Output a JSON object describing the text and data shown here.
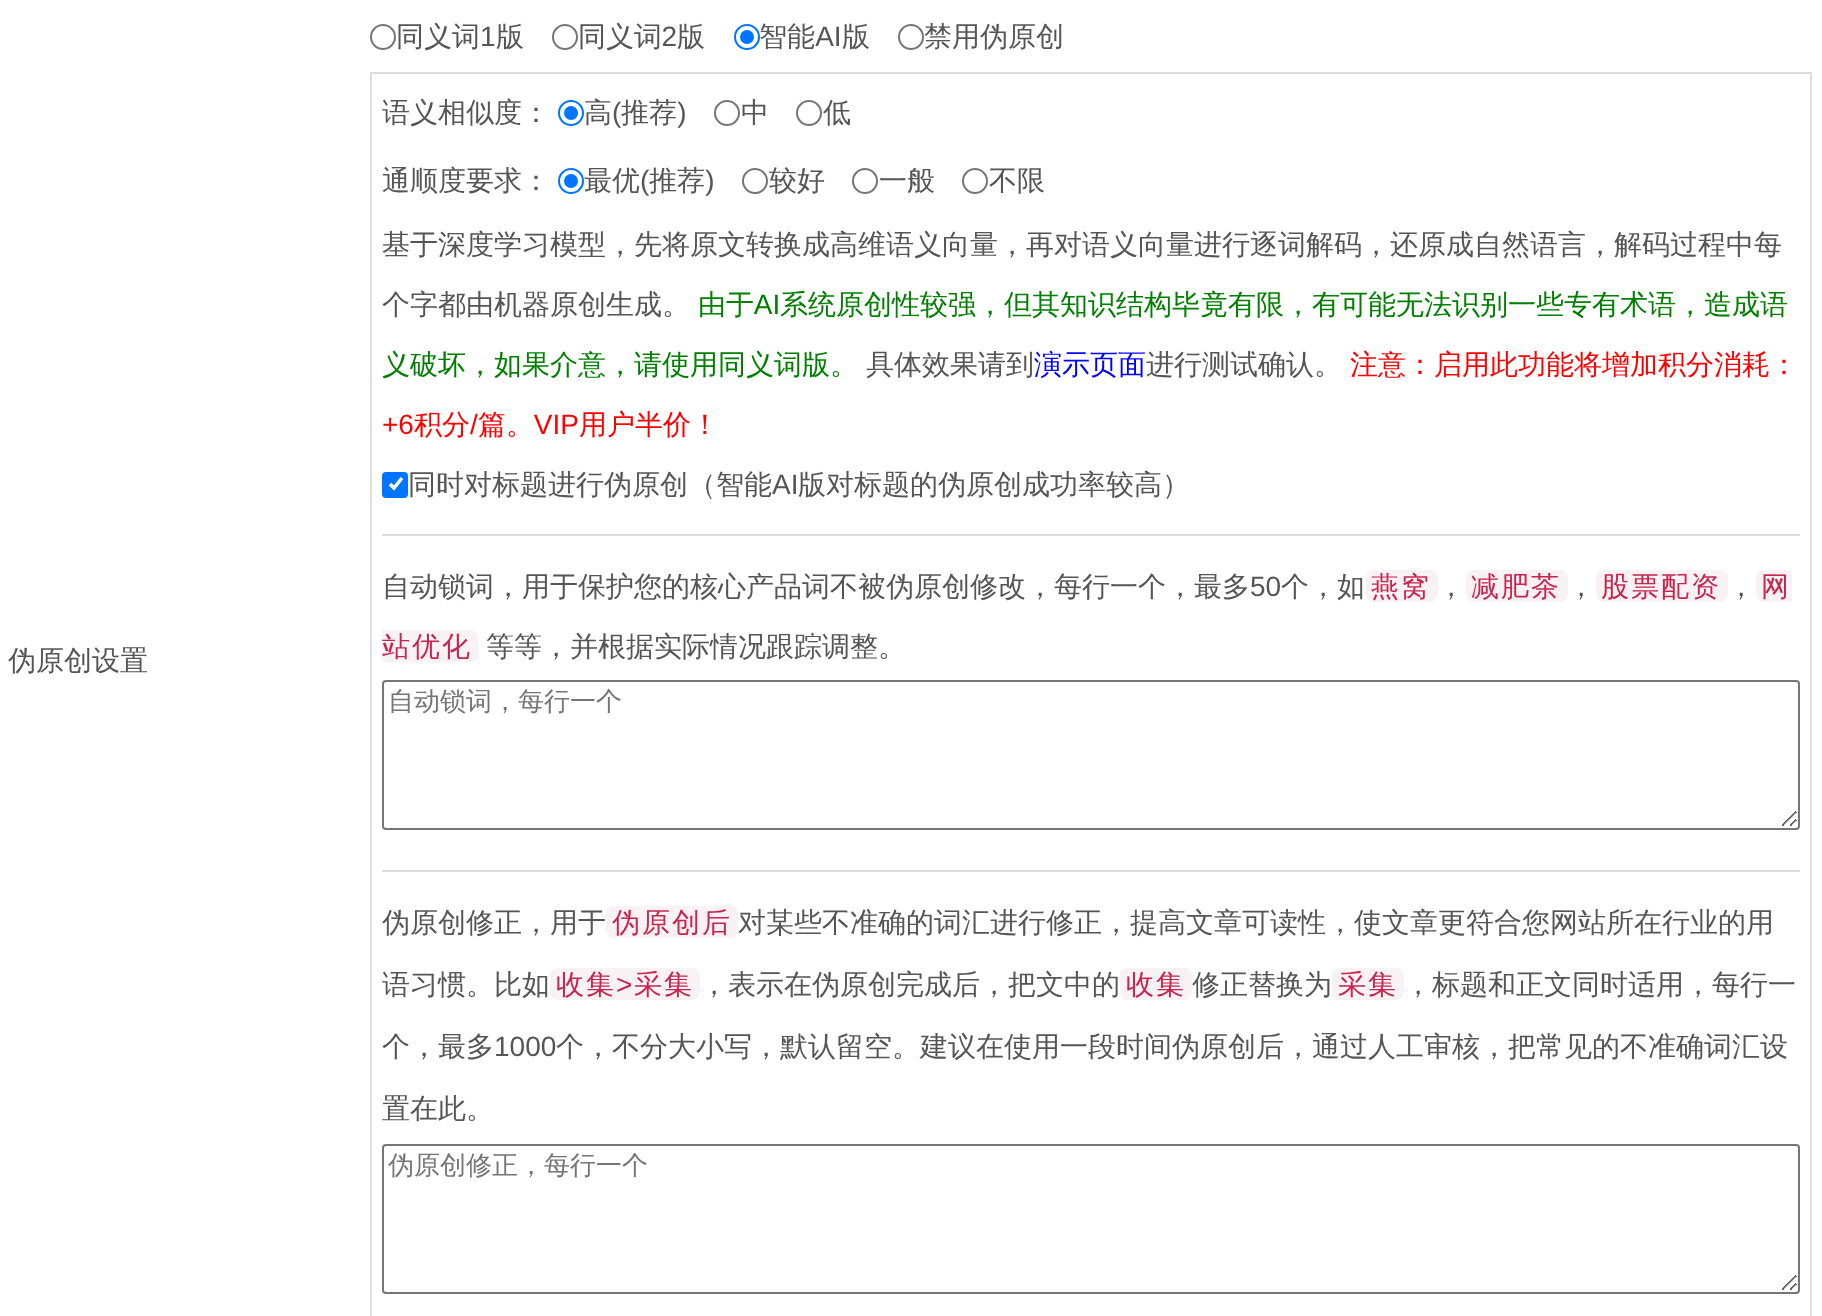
{
  "section_label": "伪原创设置",
  "modes": [
    {
      "label": "同义词1版",
      "selected": false
    },
    {
      "label": "同义词2版",
      "selected": false
    },
    {
      "label": "智能AI版",
      "selected": true
    },
    {
      "label": "禁用伪原创",
      "selected": false
    }
  ],
  "settings": [
    {
      "label": "语义相似度：",
      "options": [
        {
          "label": "高(推荐)",
          "selected": true
        },
        {
          "label": "中",
          "selected": false
        },
        {
          "label": "低",
          "selected": false
        }
      ]
    },
    {
      "label": "通顺度要求：",
      "options": [
        {
          "label": "最优(推荐)",
          "selected": true
        },
        {
          "label": "较好",
          "selected": false
        },
        {
          "label": "一般",
          "selected": false
        },
        {
          "label": "不限",
          "selected": false
        }
      ]
    }
  ],
  "ai_description": [
    {
      "kind": "plain",
      "text": "基于深度学习模型，先将原文转换成高维语义向量，再对语义向量进行逐词解码，还原成自然语言，解码过程中每个字都由机器原创生成。 "
    },
    {
      "kind": "note",
      "text": "由于AI系统原创性较强，但其知识结构毕竟有限，有可能无法识别一些专有术语，造成语义破坏，如果介意，请使用同义词版。"
    },
    {
      "kind": "plain",
      "text": " 具体效果请到"
    },
    {
      "kind": "link",
      "text": "演示页面"
    },
    {
      "kind": "plain",
      "text": "进行测试确认。 "
    },
    {
      "kind": "warning",
      "text": "注意：启用此功能将增加积分消耗：+6积分/篇。VIP用户半价！"
    }
  ],
  "title_option": {
    "label": "同时对标题进行伪原创（智能AI版对标题的伪原创成功率较高）",
    "checked": true
  },
  "lock_words": {
    "description": [
      {
        "kind": "plain",
        "text": "自动锁词，用于保护您的核心产品词不被伪原创修改，每行一个，最多50个，如"
      },
      {
        "kind": "tag",
        "text": "燕窝"
      },
      {
        "kind": "plain",
        "text": "，"
      },
      {
        "kind": "tag",
        "text": "减肥茶"
      },
      {
        "kind": "plain",
        "text": "，"
      },
      {
        "kind": "tag",
        "text": "股票配资"
      },
      {
        "kind": "plain",
        "text": "，"
      },
      {
        "kind": "tag",
        "text": "网站优化"
      },
      {
        "kind": "plain",
        "text": " 等等，并根据实际情况跟踪调整。"
      }
    ],
    "placeholder": "自动锁词，每行一个"
  },
  "correction": {
    "description": [
      {
        "kind": "plain",
        "text": "伪原创修正，用于"
      },
      {
        "kind": "tag",
        "text": "伪原创后"
      },
      {
        "kind": "plain",
        "text": "对某些不准确的词汇进行修正，提高文章可读性，使文章更符合您网站所在行业的用语习惯。比如"
      },
      {
        "kind": "tag",
        "text": "收集>采集"
      },
      {
        "kind": "plain",
        "text": "，表示在伪原创完成后，把文中的"
      },
      {
        "kind": "tag",
        "text": "收集"
      },
      {
        "kind": "plain",
        "text": "修正替换为"
      },
      {
        "kind": "tag",
        "text": "采集"
      },
      {
        "kind": "plain",
        "text": "，标题和正文同时适用，每行一个，最多1000个，不分大小写，默认留空。建议在使用一段时间伪原创后，通过人工审核，把常见的不准确词汇设置在此。"
      }
    ],
    "placeholder": "伪原创修正，每行一个"
  }
}
